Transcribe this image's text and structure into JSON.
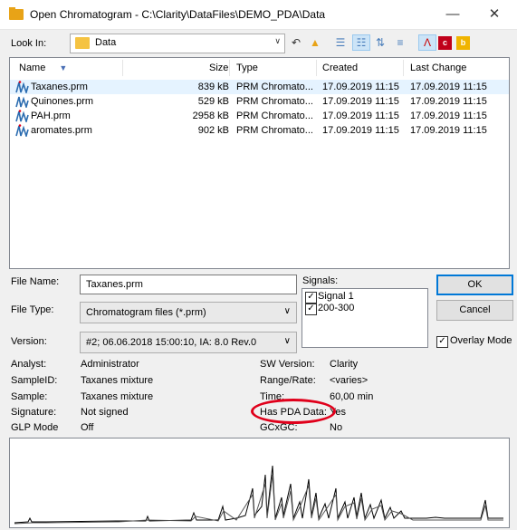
{
  "window": {
    "title": "Open Chromatogram - C:\\Clarity\\DataFiles\\DEMO_PDA\\Data",
    "minimize": "—",
    "maximize": "☐",
    "close": "✕"
  },
  "lookin": {
    "label": "Look In:",
    "value": "Data",
    "toolbar_icons": [
      "back-icon",
      "up-folder-icon",
      "list-view-icon",
      "details-view-icon",
      "sort-icon",
      "filter-icon",
      "chromatogram-icon",
      "calibration-icon",
      "template-icon"
    ]
  },
  "filelist": {
    "columns": [
      "Name",
      "Size",
      "Type",
      "Created",
      "Last Change"
    ],
    "rows": [
      {
        "name": "Taxanes.prm",
        "size": "839 kB",
        "type": "PRM Chromato...",
        "created": "17.09.2019 11:15",
        "changed": "17.09.2019 11:15"
      },
      {
        "name": "Quinones.prm",
        "size": "529 kB",
        "type": "PRM Chromato...",
        "created": "17.09.2019 11:15",
        "changed": "17.09.2019 11:15"
      },
      {
        "name": "PAH.prm",
        "size": "2958 kB",
        "type": "PRM Chromato...",
        "created": "17.09.2019 11:15",
        "changed": "17.09.2019 11:15"
      },
      {
        "name": "aromates.prm",
        "size": "902 kB",
        "type": "PRM Chromato...",
        "created": "17.09.2019 11:15",
        "changed": "17.09.2019 11:15"
      }
    ]
  },
  "form": {
    "file_name_label": "File Name:",
    "file_name_value": "Taxanes.prm",
    "file_type_label": "File Type:",
    "file_type_value": "Chromatogram files (*.prm)",
    "version_label": "Version:",
    "version_value": "#2;  06.06.2018  15:00:10,  IA: 8.0 Rev.0",
    "signals_label": "Signals:",
    "signals": [
      {
        "label": "Signal 1",
        "checked": true
      },
      {
        "label": "200-300",
        "checked": true
      }
    ],
    "ok": "OK",
    "cancel": "Cancel",
    "overlay_label": "Overlay Mode",
    "overlay_checked": true
  },
  "info": {
    "left": [
      {
        "label": "Analyst:",
        "value": "Administrator"
      },
      {
        "label": "SampleID:",
        "value": "Taxanes mixture"
      },
      {
        "label": "Sample:",
        "value": "Taxanes mixture"
      },
      {
        "label": "Signature:",
        "value": "Not signed"
      },
      {
        "label": "GLP Mode",
        "value": "Off"
      }
    ],
    "right": [
      {
        "label": "SW Version:",
        "value": "Clarity"
      },
      {
        "label": "Range/Rate:",
        "value": "<varies>"
      },
      {
        "label": "Time:",
        "value": "60,00 min"
      },
      {
        "label": "Has PDA Data:",
        "value": "Yes"
      },
      {
        "label": "GCxGC:",
        "value": "No"
      }
    ]
  },
  "colors": {
    "highlight_ellipse": "#e0001b",
    "selection": "#e5f3ff",
    "default_button": "#0078d7"
  }
}
